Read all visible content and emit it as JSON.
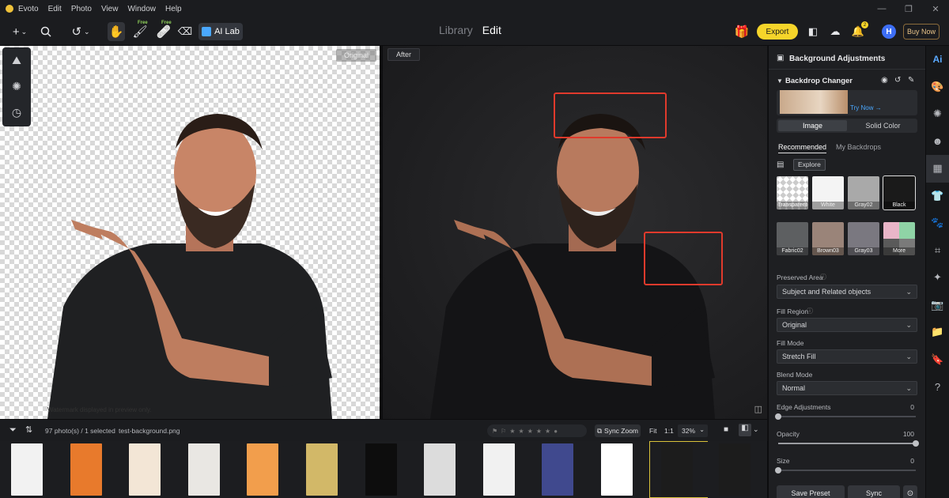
{
  "app": {
    "name": "Evoto"
  },
  "menu": [
    "Edit",
    "Photo",
    "View",
    "Window",
    "Help"
  ],
  "toolbar": {
    "free_badge": "Free",
    "ai_lab": "AI Lab",
    "modes": [
      "Library",
      "Edit"
    ],
    "active_mode": "Edit",
    "export": "Export",
    "notification_count": "2",
    "avatar_initial": "H",
    "buy_now": "Buy Now"
  },
  "canvas": {
    "original_tag": "Original",
    "after_tag": "After",
    "watermark_notice": "Watermark displayed in preview only."
  },
  "filmstrip": {
    "count": "97 photo(s) / 1 selected",
    "filename": "test-background.png",
    "sync_zoom": "Sync Zoom",
    "fit": "Fit",
    "one_to_one": "1:1",
    "zoom": "32%",
    "thumb_colors": [
      "#f2f2f2",
      "#e87a2c",
      "#f3e6d6",
      "#e9e7e3",
      "#f29e4c",
      "#d2b868",
      "#0d0d0d",
      "#dcdcdc",
      "#f1f1f1",
      "#40498e",
      "#ffffff",
      "#1c1c1c",
      "#1c1c1c"
    ],
    "selected_index": 11
  },
  "panel": {
    "title": "Background Adjustments",
    "section": "Backdrop Changer",
    "try_now": "Try Now →",
    "tabs": [
      "Image",
      "Solid Color"
    ],
    "subtabs": [
      "Recommended",
      "My Backdrops"
    ],
    "explore": "Explore",
    "backdrops": [
      {
        "name": "Transparent",
        "color": "#e8e8e8"
      },
      {
        "name": "White",
        "color": "#f4f4f4"
      },
      {
        "name": "Gray02",
        "color": "#a9a9a9"
      },
      {
        "name": "Black",
        "color": "#1a1a1a"
      },
      {
        "name": "Fabric02",
        "color": "#5d5f61"
      },
      {
        "name": "Brown03",
        "color": "#9a8479"
      },
      {
        "name": "Gray03",
        "color": "#7a7880"
      },
      {
        "name": "More",
        "color": "#7d8a86"
      }
    ],
    "preserved_area_label": "Preserved Area",
    "preserved_area": "Subject and Related objects",
    "fill_region_label": "Fill Region",
    "fill_region": "Original",
    "fill_mode_label": "Fill Mode",
    "fill_mode": "Stretch Fill",
    "blend_mode_label": "Blend Mode",
    "blend_mode": "Normal",
    "edge_label": "Edge Adjustments",
    "edge_value": "0",
    "opacity_label": "Opacity",
    "opacity_value": "100",
    "size_label": "Size",
    "size_value": "0",
    "save_preset": "Save Preset",
    "sync": "Sync"
  },
  "colors": {
    "accent": "#f6d52a",
    "highlight_box": "#e03a2c",
    "panel": "#1e1f22"
  }
}
